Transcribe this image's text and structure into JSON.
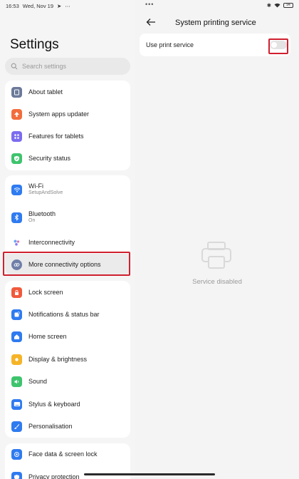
{
  "status_bar": {
    "time": "16:53",
    "date": "Wed, Nov 19",
    "battery": "94"
  },
  "left": {
    "title": "Settings",
    "search_placeholder": "Search settings",
    "groups": [
      [
        {
          "label": "About tablet",
          "icon": "tablet-icon",
          "color": "#6c7a99"
        },
        {
          "label": "System apps updater",
          "icon": "arrow-up-icon",
          "color": "#f26d3d"
        },
        {
          "label": "Features for tablets",
          "icon": "grid-icon",
          "color": "#7b6cf0"
        },
        {
          "label": "Security status",
          "icon": "shield-check-icon",
          "color": "#3ec46d"
        }
      ],
      [
        {
          "label": "Wi-Fi",
          "sub": "SetupAndSolve",
          "icon": "wifi-icon",
          "color": "#2f7bf0"
        },
        {
          "label": "Bluetooth",
          "sub": "On",
          "icon": "bluetooth-icon",
          "color": "#2f7bf0"
        },
        {
          "label": "Interconnectivity",
          "icon": "interconnectivity-icon",
          "color": "#ffffff"
        },
        {
          "label": "More connectivity options",
          "icon": "link-icon",
          "color": "#6f7fa8"
        }
      ],
      [
        {
          "label": "Lock screen",
          "icon": "lock-icon",
          "color": "#f05a3c"
        },
        {
          "label": "Notifications & status bar",
          "icon": "notification-icon",
          "color": "#2f7bf0"
        },
        {
          "label": "Home screen",
          "icon": "home-icon",
          "color": "#2f7bf0"
        },
        {
          "label": "Display & brightness",
          "icon": "sun-icon",
          "color": "#f5b428"
        },
        {
          "label": "Sound",
          "icon": "sound-icon",
          "color": "#3ec46d"
        },
        {
          "label": "Stylus & keyboard",
          "icon": "keyboard-icon",
          "color": "#2f7bf0"
        },
        {
          "label": "Personalisation",
          "icon": "brush-icon",
          "color": "#2f7bf0"
        }
      ],
      [
        {
          "label": "Face data & screen lock",
          "icon": "face-icon",
          "color": "#2f7bf0"
        },
        {
          "label": "Privacy protection",
          "icon": "privacy-icon",
          "color": "#2f7bf0"
        }
      ]
    ]
  },
  "right": {
    "title": "System printing service",
    "setting_label": "Use print service",
    "toggle_on": false,
    "empty_text": "Service disabled"
  }
}
